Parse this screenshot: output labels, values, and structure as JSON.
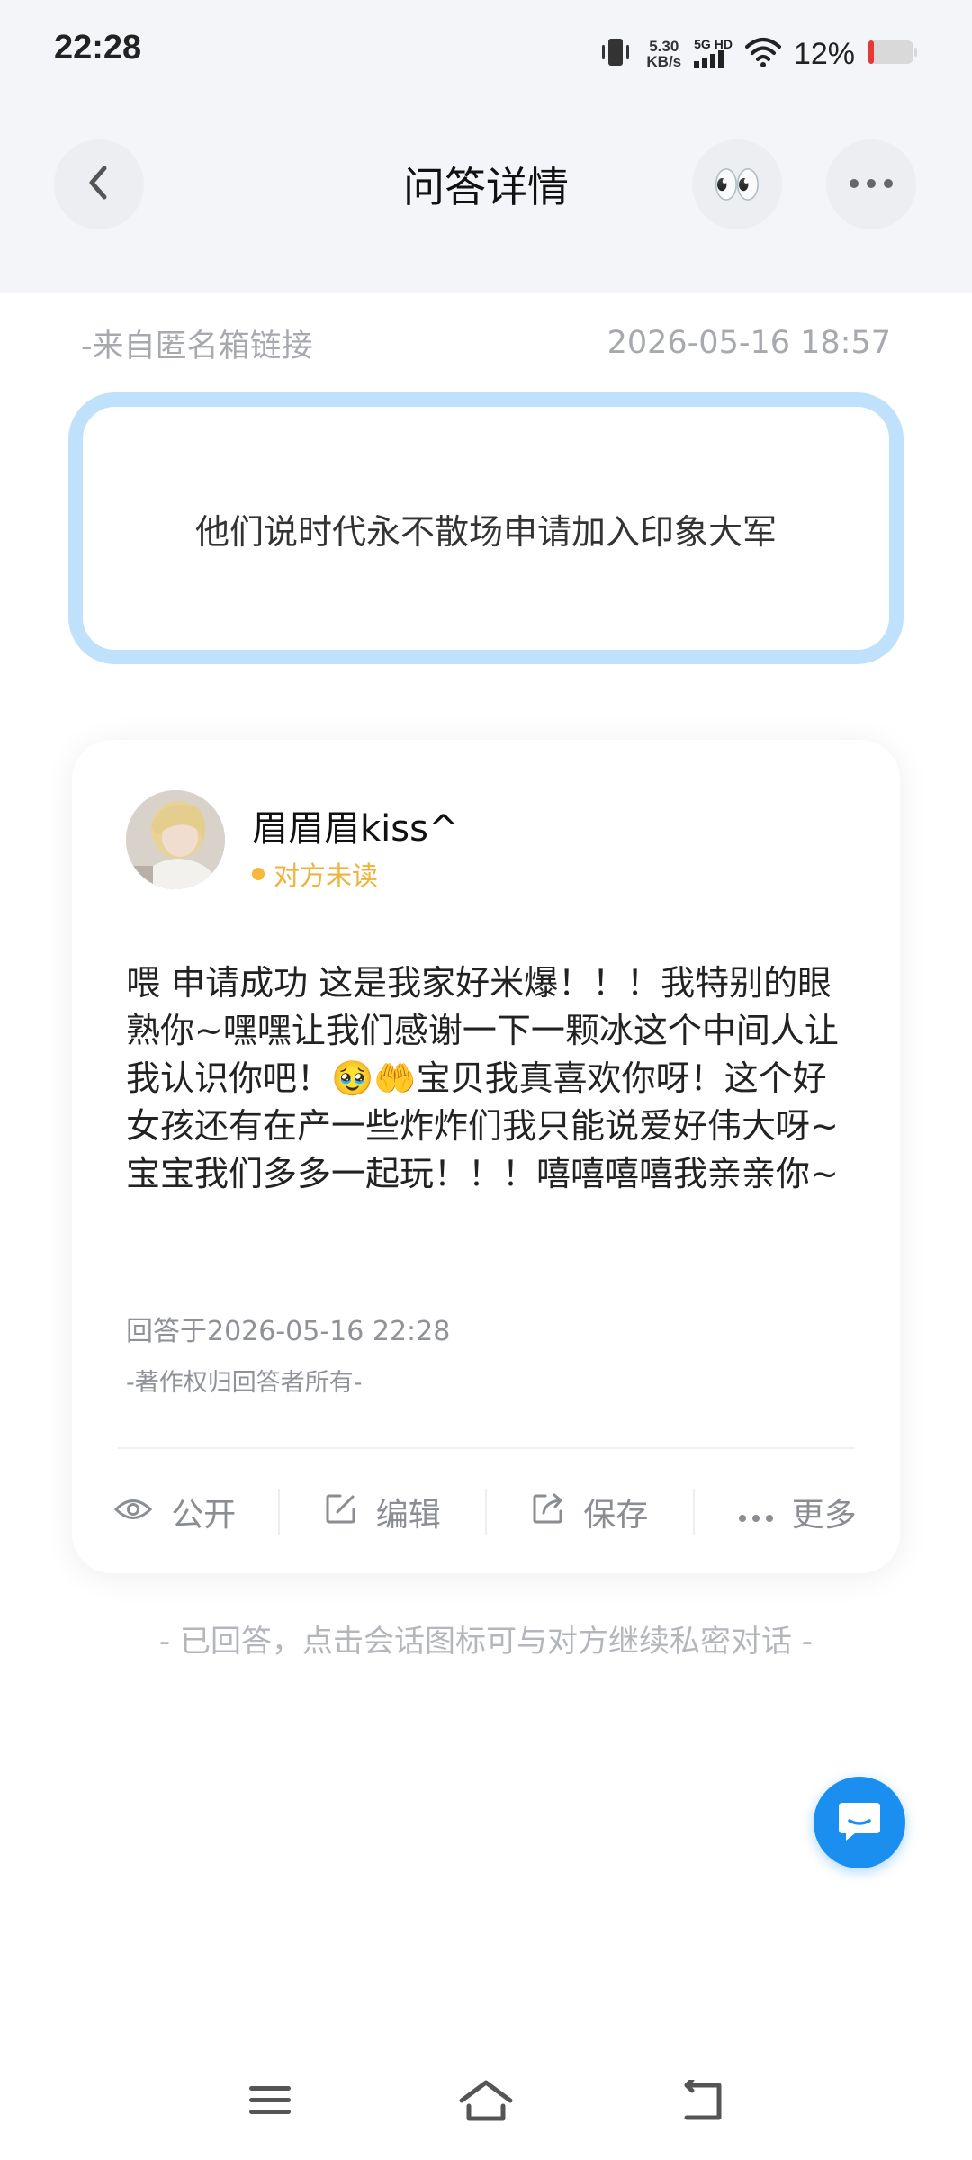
{
  "status_bar": {
    "time": "22:28",
    "net_speed_value": "5.30",
    "net_speed_unit": "KB/s",
    "network_type": "5G HD",
    "battery_percent": "12%",
    "battery_level": 0.12,
    "icons": [
      "vibrate-icon",
      "signal-icon",
      "wifi-icon",
      "battery-icon"
    ]
  },
  "header": {
    "title": "问答详情",
    "back_icon": "chevron-left-icon",
    "eyes_icon": "eyes-emoji-icon",
    "eyes_glyph": "👀",
    "more_icon": "more-horizontal-icon"
  },
  "question": {
    "source": "-来自匿名箱链接",
    "timestamp": "2026-05-16 18:57",
    "text": "他们说时代永不散场申请加入印象大军"
  },
  "answer": {
    "user_name": "眉眉眉kiss^",
    "read_status": "对方未读",
    "text": "喂 申请成功 这是我家好米爆！！！我特别的眼熟你~嘿嘿让我们感谢一下一颗冰这个中间人让我认识你吧！🥹🤲宝贝我真喜欢你呀！这个好女孩还有在产一些炸炸们我只能说爱好伟大呀~宝宝我们多多一起玩！！！嘻嘻嘻嘻我亲亲你~",
    "answered_at": "回答于2026-05-16 22:28",
    "copyright": "-著作权归回答者所有-",
    "actions": [
      {
        "label": "公开",
        "icon": "eye-icon"
      },
      {
        "label": "编辑",
        "icon": "edit-icon"
      },
      {
        "label": "保存",
        "icon": "share-export-icon"
      },
      {
        "label": "更多",
        "icon": "more-dots-icon"
      }
    ]
  },
  "footer_hint": "- 已回答，点击会话图标可与对方继续私密对话 -",
  "colors": {
    "accent_blue": "#1a8ff0",
    "question_border": "#bfe1fb",
    "unread_orange": "#f0b23a",
    "header_bg": "#f4f5f8"
  }
}
